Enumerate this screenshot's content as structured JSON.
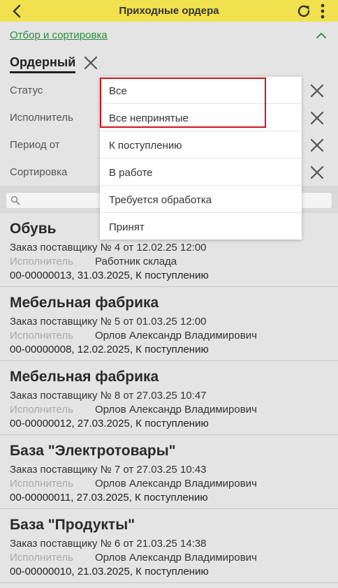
{
  "header": {
    "title": "Приходные ордера",
    "back_icon": "arrow-back-icon",
    "refresh_icon": "refresh-icon",
    "more_icon": "more-vertical-icon",
    "accent_color": "#f2e14f"
  },
  "filter": {
    "toggle_label": "Отбор и сортировка",
    "tab_label": "Ордерный",
    "rows": [
      {
        "label": "Статус"
      },
      {
        "label": "Исполнитель"
      },
      {
        "label": "Период от"
      },
      {
        "label": "Сортировка"
      }
    ]
  },
  "dropdown": {
    "options": [
      "Все",
      "Все непринятые",
      "К поступлению",
      "В работе",
      "Требуется обработка",
      "Принят"
    ],
    "highlight_color": "#d0131b"
  },
  "search": {
    "placeholder": ""
  },
  "list": {
    "executor_label": "Исполнитель",
    "items": [
      {
        "title": "Обувь",
        "order": "Заказ поставщику № 4 от 12.02.25 12:00",
        "executor": "Работник склада",
        "doc": "00-00000013, 31.03.2025, К поступлению"
      },
      {
        "title": "Мебельная фабрика",
        "order": "Заказ поставщику № 5 от 01.03.25 12:00",
        "executor": "Орлов Александр Владимирович",
        "doc": "00-00000008, 12.02.2025, К поступлению"
      },
      {
        "title": "Мебельная фабрика",
        "order": "Заказ поставщику № 8 от 27.03.25 10:47",
        "executor": "Орлов Александр Владимирович",
        "doc": "00-00000012, 27.03.2025, К поступлению"
      },
      {
        "title": "База \"Электротовары\"",
        "order": "Заказ поставщику № 7 от 27.03.25 10:43",
        "executor": "Орлов Александр Владимирович",
        "doc": "00-00000011, 27.03.2025, К поступлению"
      },
      {
        "title": "База \"Продукты\"",
        "order": "Заказ поставщику № 6 от 21.03.25 14:38",
        "executor": "Орлов Александр Владимирович",
        "doc": "00-00000010, 21.03.2025, К поступлению"
      }
    ]
  }
}
